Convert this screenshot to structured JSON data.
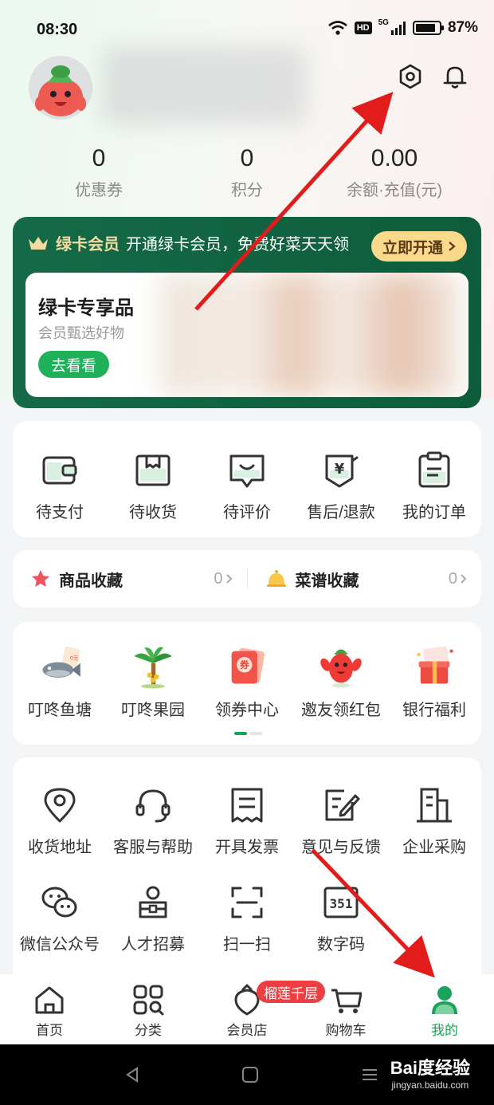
{
  "status_bar": {
    "time": "08:30",
    "hd": "HD",
    "signal": "5G",
    "battery_percent": "87%",
    "battery_level": 0.87
  },
  "header": {
    "settings_icon": "hexagon-settings-icon",
    "bell_icon": "bell-icon"
  },
  "stats": [
    {
      "value": "0",
      "label": "优惠券"
    },
    {
      "value": "0",
      "label": "积分"
    },
    {
      "value": "0.00",
      "label": "余额·充值(元)"
    }
  ],
  "green_card": {
    "brand": "绿卡会员",
    "promo": "开通绿卡会员，免费好菜天天领",
    "open_button": "立即开通",
    "inner_title": "绿卡专享品",
    "inner_subtitle": "会员甄选好物",
    "inner_button": "去看看"
  },
  "orders": [
    {
      "label": "待支付",
      "icon": "wallet-icon"
    },
    {
      "label": "待收货",
      "icon": "box-icon"
    },
    {
      "label": "待评价",
      "icon": "comment-icon"
    },
    {
      "label": "售后/退款",
      "icon": "refund-icon"
    },
    {
      "label": "我的订单",
      "icon": "clipboard-icon"
    }
  ],
  "favorites": [
    {
      "label": "商品收藏",
      "count": "0",
      "icon": "star-icon"
    },
    {
      "label": "菜谱收藏",
      "count": "0",
      "icon": "bell-icon"
    }
  ],
  "activities": [
    {
      "label": "叮咚鱼塘",
      "icon": "fish-icon"
    },
    {
      "label": "叮咚果园",
      "icon": "tree-icon"
    },
    {
      "label": "领券中心",
      "icon": "coupon-icon",
      "badge": "券"
    },
    {
      "label": "邀友领红包",
      "icon": "radish-icon"
    },
    {
      "label": "银行福利",
      "icon": "gift-icon"
    }
  ],
  "services": [
    {
      "label": "收货地址",
      "icon": "location-icon"
    },
    {
      "label": "客服与帮助",
      "icon": "headset-icon"
    },
    {
      "label": "开具发票",
      "icon": "invoice-icon"
    },
    {
      "label": "意见与反馈",
      "icon": "edit-icon"
    },
    {
      "label": "企业采购",
      "icon": "building-icon"
    },
    {
      "label": "微信公众号",
      "icon": "wechat-icon"
    },
    {
      "label": "人才招募",
      "icon": "recruit-icon"
    },
    {
      "label": "扫一扫",
      "icon": "scan-icon"
    },
    {
      "label": "数字码",
      "icon": "digital-code-icon",
      "code_text": "351"
    }
  ],
  "tabbar": {
    "badge": "榴莲千层",
    "tabs": [
      {
        "label": "首页",
        "icon": "home-icon"
      },
      {
        "label": "分类",
        "icon": "category-icon"
      },
      {
        "label": "会员店",
        "icon": "vip-store-icon"
      },
      {
        "label": "购物车",
        "icon": "cart-icon"
      },
      {
        "label": "我的",
        "icon": "user-icon",
        "active": true
      }
    ]
  },
  "watermark": {
    "brand": "Bai度经验",
    "url": "jingyan.baidu.com"
  },
  "colors": {
    "brand_green": "#1aa35a",
    "card_green": "#146a48",
    "gold": "#fbd98b",
    "badge_red": "#ee3e41",
    "annotation_red": "#e21b1b"
  }
}
